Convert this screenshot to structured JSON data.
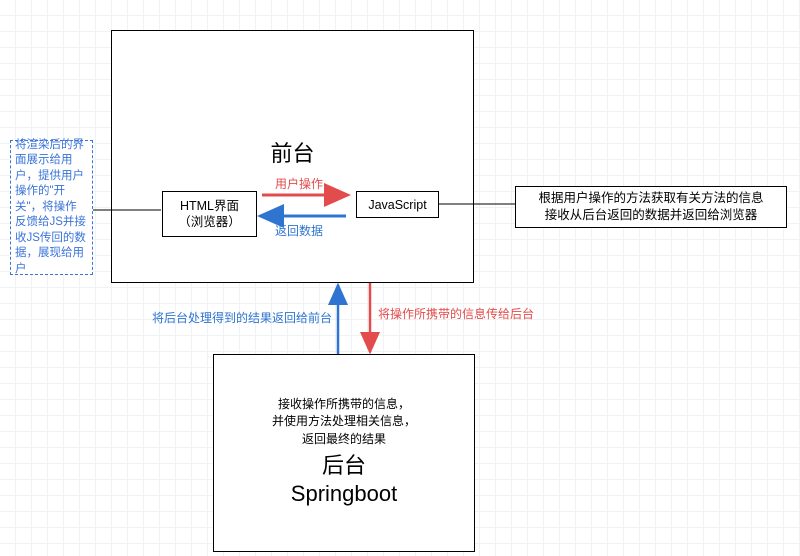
{
  "frontend": {
    "title": "前台",
    "html_box_line1": "HTML界面",
    "html_box_line2": "（浏览器）",
    "js_box": "JavaScript",
    "user_action_label": "用户操作",
    "return_data_label": "返回数据"
  },
  "backend": {
    "title_line1": "后台",
    "title_line2": "Springboot",
    "desc_line1": "接收操作所携带的信息，",
    "desc_line2": "并使用方法处理相关信息，",
    "desc_line3": "返回最终的结果"
  },
  "left_desc": "将渲染后的界面展示给用户，提供用户操作的\"开关\"，将操作反馈给JS并接收JS传回的数据，展现给用户",
  "right_desc_line1": "根据用户操作的方法获取有关方法的信息",
  "right_desc_line2": "接收从后台返回的数据并返回给浏览器",
  "js_to_backend_label": "将操作所携带的信息传给后台",
  "backend_to_frontend_label": "将后台处理得到的结果返回给前台"
}
